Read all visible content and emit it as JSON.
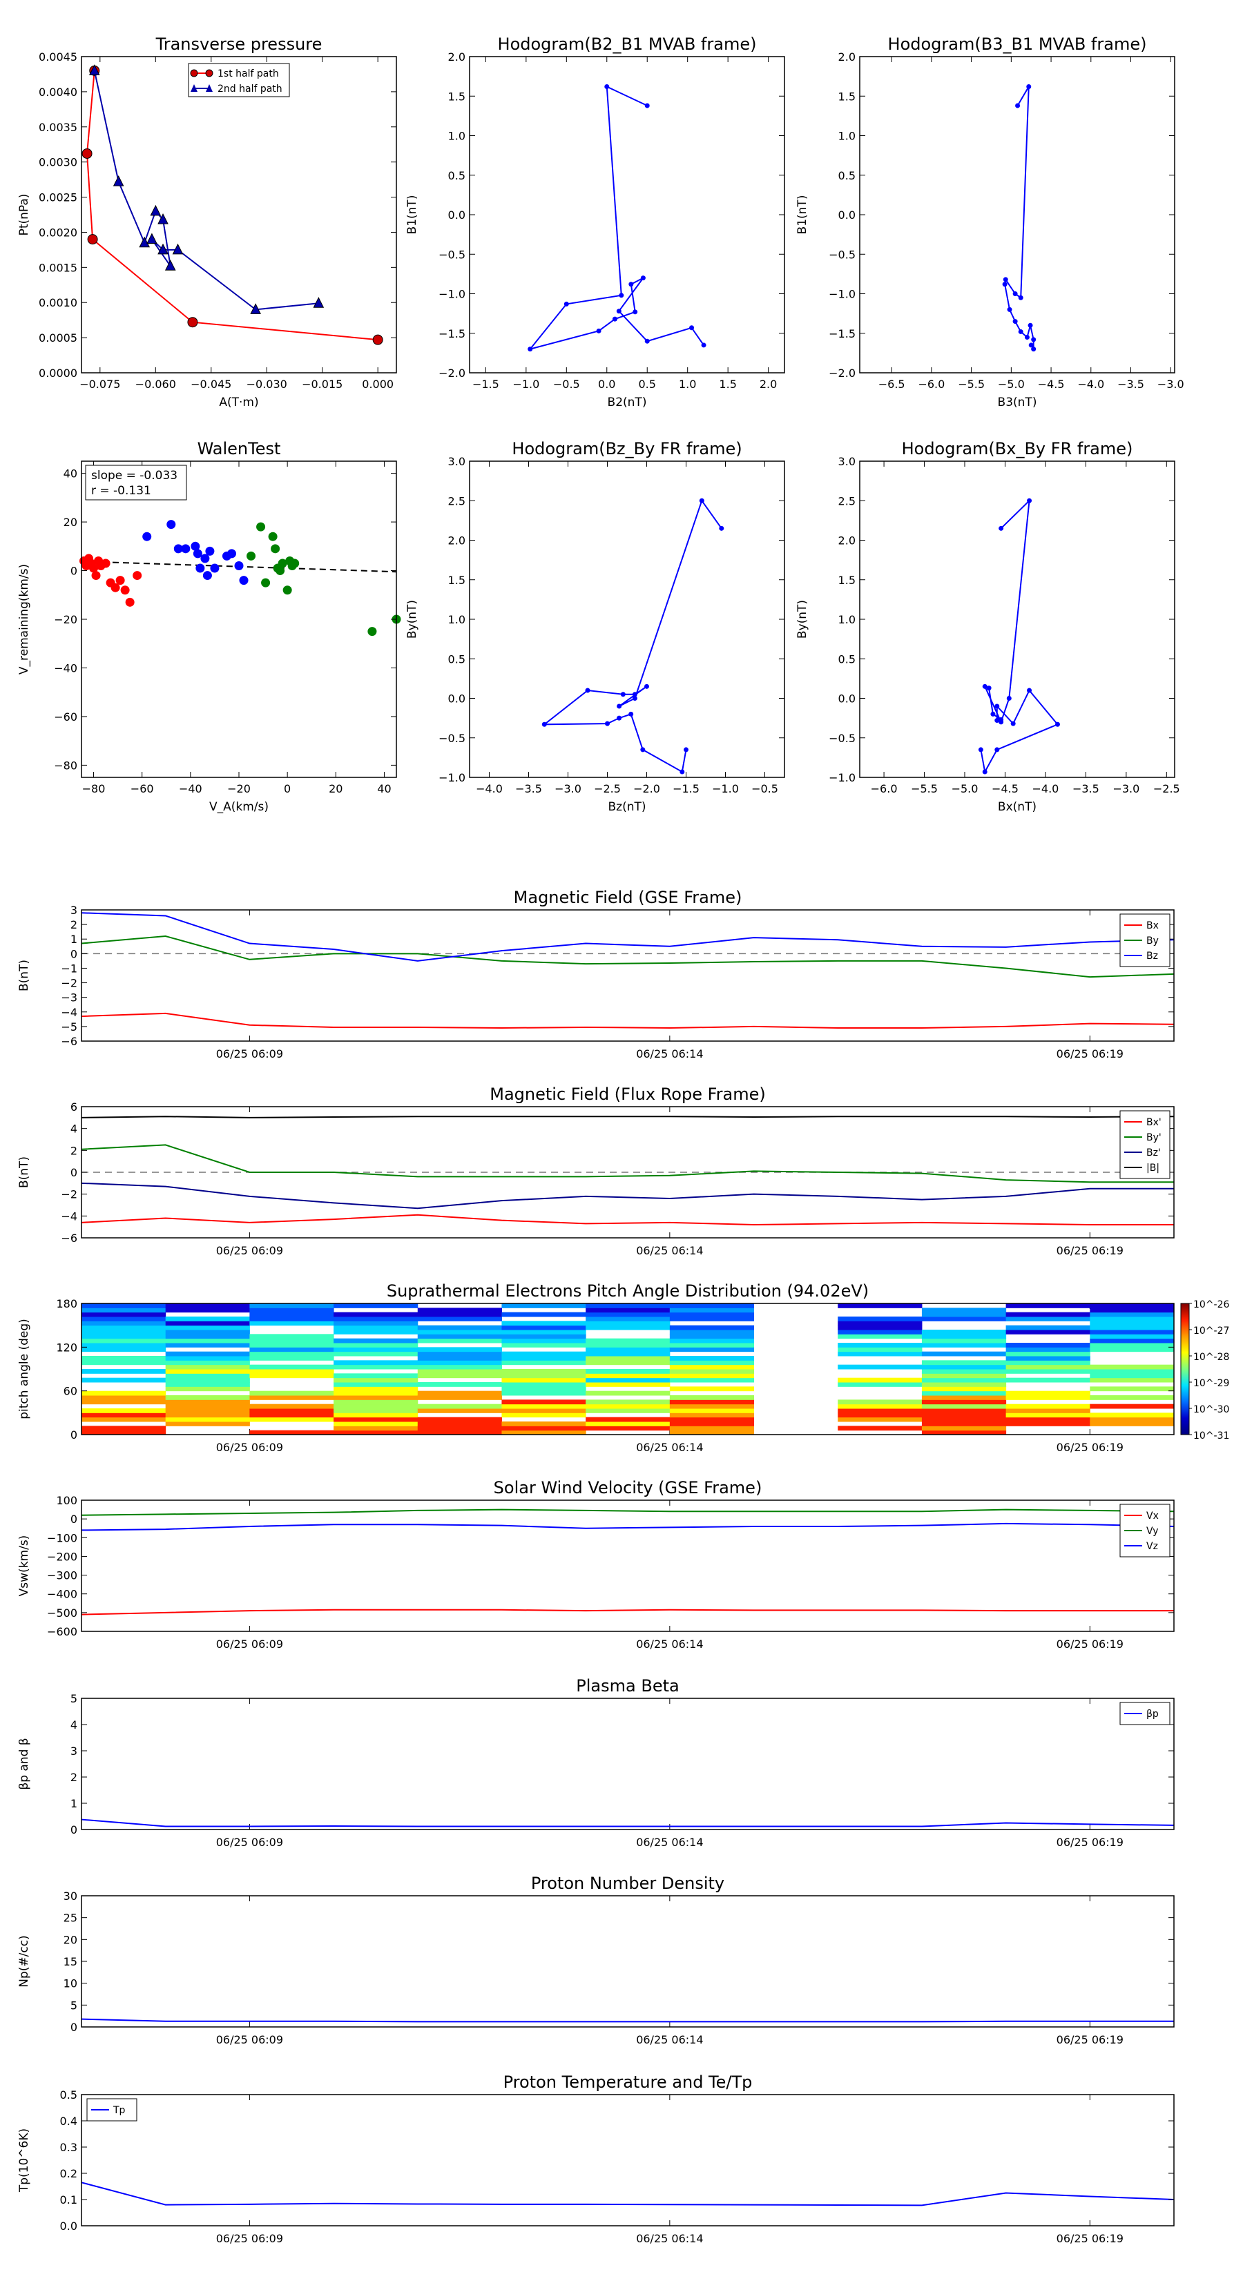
{
  "chart_data": [
    {
      "id": "tp",
      "type": "line",
      "title": "Transverse pressure",
      "xlabel": "A(T·m)",
      "ylabel": "Pt(nPa)",
      "xlim": [
        -0.08,
        0.005
      ],
      "ylim": [
        0,
        0.0045
      ],
      "xticks": [
        -0.075,
        -0.06,
        -0.045,
        -0.03,
        -0.015,
        0.0
      ],
      "xtick_labels": [
        "−0.075",
        "−0.060",
        "−0.045",
        "−0.030",
        "−0.015",
        "0.000"
      ],
      "yticks": [
        0,
        0.0005,
        0.001,
        0.0015,
        0.002,
        0.0025,
        0.003,
        0.0035,
        0.004,
        0.0045
      ],
      "ytick_labels": [
        "0.0000",
        "0.0005",
        "0.0010",
        "0.0015",
        "0.0020",
        "0.0025",
        "0.0030",
        "0.0035",
        "0.0040",
        "0.0045"
      ],
      "legend": [
        "1st half path",
        "2nd half path"
      ],
      "series": [
        {
          "name": "1st half path",
          "color": "#ff0000",
          "marker": "circle",
          "x": [
            0.0,
            -0.05,
            -0.077,
            -0.0785,
            -0.0765
          ],
          "y": [
            0.00047,
            0.00072,
            0.0019,
            0.00312,
            0.0043
          ]
        },
        {
          "name": "2nd half path",
          "color": "#0000aa",
          "marker": "triangle",
          "x": [
            -0.0765,
            -0.07,
            -0.063,
            -0.06,
            -0.058,
            -0.056,
            -0.061,
            -0.058,
            -0.054,
            -0.033,
            -0.016
          ],
          "y": [
            0.0043,
            0.00272,
            0.00185,
            0.0023,
            0.00218,
            0.00152,
            0.0019,
            0.00175,
            0.00175,
            0.0009,
            0.00099
          ]
        }
      ]
    },
    {
      "id": "h1",
      "type": "line",
      "title": "Hodogram(B2_B1 MVAB frame)",
      "xlabel": "B2(nT)",
      "ylabel": "B1(nT)",
      "xlim": [
        -1.7,
        2.2
      ],
      "ylim": [
        -2.0,
        2.0
      ],
      "xticks": [
        -1.5,
        -1.0,
        -0.5,
        0.0,
        0.5,
        1.0,
        1.5,
        2.0
      ],
      "xtick_labels": [
        "−1.5",
        "−1.0",
        "−0.5",
        "0.0",
        "0.5",
        "1.0",
        "1.5",
        "2.0"
      ],
      "yticks": [
        -2.0,
        -1.5,
        -1.0,
        -0.5,
        0.0,
        0.5,
        1.0,
        1.5,
        2.0
      ],
      "ytick_labels": [
        "−2.0",
        "−1.5",
        "−1.0",
        "−0.5",
        "0.0",
        "0.5",
        "1.0",
        "1.5",
        "2.0"
      ],
      "series": [
        {
          "color": "#0000ff",
          "marker": "dot",
          "x": [
            0.5,
            0.0,
            0.18,
            -0.5,
            -0.95,
            -0.1,
            0.1,
            0.35,
            0.3,
            0.45,
            0.15,
            0.5,
            1.05,
            1.2
          ],
          "y": [
            1.38,
            1.62,
            -1.02,
            -1.13,
            -1.7,
            -1.47,
            -1.32,
            -1.23,
            -0.88,
            -0.8,
            -1.22,
            -1.6,
            -1.43,
            -1.65
          ]
        }
      ]
    },
    {
      "id": "h2",
      "type": "line",
      "title": "Hodogram(B3_B1 MVAB frame)",
      "xlabel": "B3(nT)",
      "ylabel": "B1(nT)",
      "xlim": [
        -6.9,
        -2.95
      ],
      "ylim": [
        -2.0,
        2.0
      ],
      "xticks": [
        -6.5,
        -6.0,
        -5.5,
        -5.0,
        -4.5,
        -4.0,
        -3.5,
        -3.0
      ],
      "xtick_labels": [
        "−6.5",
        "−6.0",
        "−5.5",
        "−5.0",
        "−4.5",
        "−4.0",
        "−3.5",
        "−3.0"
      ],
      "yticks": [
        -2.0,
        -1.5,
        -1.0,
        -0.5,
        0.0,
        0.5,
        1.0,
        1.5,
        2.0
      ],
      "ytick_labels": [
        "−2.0",
        "−1.5",
        "−1.0",
        "−0.5",
        "0.0",
        "0.5",
        "1.0",
        "1.5",
        "2.0"
      ],
      "series": [
        {
          "color": "#0000ff",
          "marker": "dot",
          "x": [
            -4.92,
            -4.78,
            -4.88,
            -4.95,
            -5.07,
            -5.08,
            -5.02,
            -4.95,
            -4.88,
            -4.8,
            -4.76,
            -4.72,
            -4.72,
            -4.75
          ],
          "y": [
            1.38,
            1.62,
            -1.05,
            -1.0,
            -0.82,
            -0.88,
            -1.2,
            -1.35,
            -1.48,
            -1.55,
            -1.4,
            -1.58,
            -1.7,
            -1.65
          ]
        }
      ]
    },
    {
      "id": "walen",
      "type": "scatter",
      "title": "WalenTest",
      "xlabel": "V_A(km/s)",
      "ylabel": "V_remaining(km/s)",
      "xlim": [
        -85,
        45
      ],
      "ylim": [
        -85,
        45
      ],
      "xticks": [
        -80,
        -60,
        -40,
        -20,
        0,
        20,
        40
      ],
      "xtick_labels": [
        "−80",
        "−60",
        "−40",
        "−20",
        "0",
        "20",
        "40"
      ],
      "yticks": [
        -80,
        -60,
        -40,
        -20,
        0,
        20,
        40
      ],
      "ytick_labels": [
        "−80",
        "−60",
        "−40",
        "−20",
        "0",
        "20",
        "40"
      ],
      "annotation": [
        "slope = -0.033",
        "r = -0.131"
      ],
      "fit": {
        "slope": -0.033,
        "intercept": 1.0
      },
      "series": [
        {
          "color": "#ff0000",
          "x": [
            -84,
            -83,
            -82,
            -81,
            -80,
            -79,
            -78,
            -77,
            -75,
            -73,
            -71,
            -69,
            -67,
            -65,
            -62
          ],
          "y": [
            4,
            2,
            5,
            3,
            1,
            -2,
            4,
            2,
            3,
            -5,
            -7,
            -4,
            -8,
            -13,
            -2
          ]
        },
        {
          "color": "#0000ff",
          "x": [
            -58,
            -48,
            -45,
            -42,
            -38,
            -37,
            -36,
            -34,
            -33,
            -32,
            -30,
            -25,
            -23,
            -20,
            -18
          ],
          "y": [
            14,
            19,
            9,
            9,
            10,
            7,
            1,
            5,
            -2,
            8,
            1,
            6,
            7,
            2,
            -4
          ]
        },
        {
          "color": "#008000",
          "x": [
            -15,
            -11,
            -9,
            -6,
            -5,
            -4,
            -3,
            -2,
            0,
            1,
            2,
            3,
            35,
            45
          ],
          "y": [
            6,
            18,
            -5,
            14,
            9,
            1,
            0,
            3,
            -8,
            4,
            2,
            3,
            -25,
            -20
          ]
        }
      ]
    },
    {
      "id": "h3",
      "type": "line",
      "title": "Hodogram(Bz_By FR frame)",
      "xlabel": "Bz(nT)",
      "ylabel": "By(nT)",
      "xlim": [
        -4.25,
        -0.25
      ],
      "ylim": [
        -1.0,
        3.0
      ],
      "xticks": [
        -4.0,
        -3.5,
        -3.0,
        -2.5,
        -2.0,
        -1.5,
        -1.0,
        -0.5
      ],
      "xtick_labels": [
        "−4.0",
        "−3.5",
        "−3.0",
        "−2.5",
        "−2.0",
        "−1.5",
        "−1.0",
        "−0.5"
      ],
      "yticks": [
        -1.0,
        -0.5,
        0.0,
        0.5,
        1.0,
        1.5,
        2.0,
        2.5,
        3.0
      ],
      "ytick_labels": [
        "−1.0",
        "−0.5",
        "0.0",
        "0.5",
        "1.0",
        "1.5",
        "2.0",
        "2.5",
        "3.0"
      ],
      "series": [
        {
          "color": "#0000ff",
          "marker": "dot",
          "x": [
            -1.05,
            -1.3,
            -2.15,
            -2.35,
            -2.0,
            -2.15,
            -2.3,
            -2.75,
            -3.3,
            -2.5,
            -2.35,
            -2.2,
            -2.05,
            -1.55,
            -1.5
          ],
          "y": [
            2.15,
            2.5,
            0.0,
            -0.1,
            0.15,
            0.05,
            0.05,
            0.1,
            -0.33,
            -0.32,
            -0.25,
            -0.2,
            -0.65,
            -0.93,
            -0.65
          ]
        }
      ]
    },
    {
      "id": "h4",
      "type": "line",
      "title": "Hodogram(Bx_By FR frame)",
      "xlabel": "Bx(nT)",
      "ylabel": "By(nT)",
      "xlim": [
        -6.3,
        -2.4
      ],
      "ylim": [
        -1.0,
        3.0
      ],
      "xticks": [
        -6.0,
        -5.5,
        -5.0,
        -4.5,
        -4.0,
        -3.5,
        -3.0,
        -2.5
      ],
      "xtick_labels": [
        "−6.0",
        "−5.5",
        "−5.0",
        "−4.5",
        "−4.0",
        "−3.5",
        "−3.0",
        "−2.5"
      ],
      "yticks": [
        -1.0,
        -0.5,
        0.0,
        0.5,
        1.0,
        1.5,
        2.0,
        2.5,
        3.0
      ],
      "ytick_labels": [
        "−1.0",
        "−0.5",
        "0.0",
        "0.5",
        "1.0",
        "1.5",
        "2.0",
        "2.5",
        "3.0"
      ],
      "series": [
        {
          "color": "#0000ff",
          "marker": "dot",
          "x": [
            -4.55,
            -4.2,
            -4.45,
            -4.55,
            -4.75,
            -4.7,
            -4.65,
            -4.55,
            -4.6,
            -4.6,
            -4.4,
            -4.2,
            -3.85,
            -4.6,
            -4.75,
            -4.8
          ],
          "y": [
            2.15,
            2.5,
            0.0,
            -0.3,
            0.15,
            0.13,
            -0.2,
            -0.27,
            -0.28,
            -0.1,
            -0.32,
            0.1,
            -0.33,
            -0.65,
            -0.93,
            -0.65
          ]
        }
      ]
    },
    {
      "id": "mag_gse",
      "type": "line",
      "title": "Magnetic Field (GSE Frame)",
      "ylabel": "B(nT)",
      "ylim": [
        -6,
        3
      ],
      "yticks": [
        -6,
        -5,
        -4,
        -3,
        -2,
        -1,
        0,
        1,
        2,
        3
      ],
      "ytick_labels": [
        "−6",
        "−5",
        "−4",
        "−3",
        "−2",
        "−1",
        "0",
        "1",
        "2",
        "3"
      ],
      "zero_line": true,
      "legend": [
        "Bx",
        "By",
        "Bz"
      ],
      "series": [
        {
          "name": "Bx",
          "color": "#ff0000",
          "y": [
            -4.3,
            -4.1,
            -4.9,
            -5.05,
            -5.05,
            -5.1,
            -5.05,
            -5.1,
            -5.0,
            -5.1,
            -5.1,
            -5.0,
            -4.8,
            -4.85
          ]
        },
        {
          "name": "By",
          "color": "#008000",
          "y": [
            0.7,
            1.2,
            -0.4,
            0.0,
            0.0,
            -0.5,
            -0.7,
            -0.65,
            -0.55,
            -0.5,
            -0.5,
            -1.0,
            -1.6,
            -1.4
          ]
        },
        {
          "name": "Bz",
          "color": "#0000ff",
          "y": [
            2.8,
            2.6,
            0.7,
            0.3,
            -0.5,
            0.2,
            0.7,
            0.5,
            1.1,
            0.95,
            0.5,
            0.45,
            0.8,
            0.95
          ]
        }
      ]
    },
    {
      "id": "mag_fr",
      "type": "line",
      "title": "Magnetic Field (Flux Rope Frame)",
      "ylabel": "B(nT)",
      "ylim": [
        -6,
        6
      ],
      "yticks": [
        -6,
        -4,
        -2,
        0,
        2,
        4,
        6
      ],
      "ytick_labels": [
        "−6",
        "−4",
        "−2",
        "0",
        "2",
        "4",
        "6"
      ],
      "zero_line": true,
      "legend": [
        "Bx'",
        "By'",
        "Bz'",
        "|B|"
      ],
      "series": [
        {
          "name": "Bx'",
          "color": "#ff0000",
          "y": [
            -4.6,
            -4.2,
            -4.6,
            -4.3,
            -3.9,
            -4.4,
            -4.7,
            -4.6,
            -4.8,
            -4.7,
            -4.6,
            -4.7,
            -4.8,
            -4.8
          ]
        },
        {
          "name": "By'",
          "color": "#008000",
          "y": [
            2.1,
            2.5,
            0.0,
            0.0,
            -0.4,
            -0.4,
            -0.4,
            -0.3,
            0.1,
            0.0,
            -0.1,
            -0.7,
            -0.9,
            -0.9
          ]
        },
        {
          "name": "Bz'",
          "color": "#00008b",
          "y": [
            -1.0,
            -1.3,
            -2.2,
            -2.8,
            -3.3,
            -2.6,
            -2.2,
            -2.4,
            -2.0,
            -2.2,
            -2.5,
            -2.2,
            -1.5,
            -1.5
          ]
        },
        {
          "name": "|B|",
          "color": "#000000",
          "y": [
            5.0,
            5.1,
            5.0,
            5.05,
            5.1,
            5.1,
            5.1,
            5.1,
            5.05,
            5.1,
            5.1,
            5.1,
            5.05,
            5.1
          ]
        }
      ]
    },
    {
      "id": "pad",
      "type": "heatmap",
      "title": "Suprathermal Electrons Pitch Angle Distribution (94.02eV)",
      "ylabel": "pitch angle (deg)",
      "ylim": [
        0,
        180
      ],
      "yticks": [
        0,
        60,
        120,
        180
      ],
      "ytick_labels": [
        "0",
        "60",
        "120",
        "180"
      ],
      "colorbar_labels": [
        "10^-26",
        "10^-27",
        "10^-28",
        "10^-29",
        "10^-30",
        "10^-31"
      ],
      "empty_columns": [
        8
      ]
    },
    {
      "id": "vsw",
      "type": "line",
      "title": "Solar Wind Velocity (GSE Frame)",
      "ylabel": "Vsw(km/s)",
      "ylim": [
        -600,
        100
      ],
      "yticks": [
        -600,
        -500,
        -400,
        -300,
        -200,
        -100,
        0,
        100
      ],
      "ytick_labels": [
        "−600",
        "−500",
        "−400",
        "−300",
        "−200",
        "−100",
        "0",
        "100"
      ],
      "legend": [
        "Vx",
        "Vy",
        "Vz"
      ],
      "series": [
        {
          "name": "Vx",
          "color": "#ff0000",
          "y": [
            -510,
            -500,
            -490,
            -485,
            -485,
            -485,
            -490,
            -485,
            -487,
            -487,
            -487,
            -490,
            -490,
            -490
          ]
        },
        {
          "name": "Vy",
          "color": "#008000",
          "y": [
            20,
            25,
            30,
            35,
            45,
            50,
            45,
            40,
            40,
            40,
            40,
            50,
            45,
            40
          ]
        },
        {
          "name": "Vz",
          "color": "#0000ff",
          "y": [
            -60,
            -55,
            -40,
            -30,
            -30,
            -35,
            -50,
            -45,
            -40,
            -40,
            -35,
            -25,
            -30,
            -40
          ]
        }
      ]
    },
    {
      "id": "beta",
      "type": "line",
      "title": "Plasma Beta",
      "ylabel": "βp and β",
      "ylim": [
        0,
        5
      ],
      "yticks": [
        0,
        1,
        2,
        3,
        4,
        5
      ],
      "ytick_labels": [
        "0",
        "1",
        "2",
        "3",
        "4",
        "5"
      ],
      "legend": [
        "βp"
      ],
      "series": [
        {
          "name": "βp",
          "color": "#0000ff",
          "y": [
            0.38,
            0.12,
            0.12,
            0.13,
            0.12,
            0.12,
            0.12,
            0.12,
            0.12,
            0.12,
            0.12,
            0.25,
            0.2,
            0.16
          ]
        }
      ]
    },
    {
      "id": "np",
      "type": "line",
      "title": "Proton Number Density",
      "ylabel": "Np(#/cc)",
      "ylim": [
        0,
        30
      ],
      "yticks": [
        0,
        5,
        10,
        15,
        20,
        25,
        30
      ],
      "ytick_labels": [
        "0",
        "5",
        "10",
        "15",
        "20",
        "25",
        "30"
      ],
      "series": [
        {
          "color": "#0000ff",
          "y": [
            1.8,
            1.3,
            1.3,
            1.3,
            1.2,
            1.2,
            1.2,
            1.2,
            1.2,
            1.2,
            1.2,
            1.3,
            1.3,
            1.3
          ]
        }
      ]
    },
    {
      "id": "tp_temp",
      "type": "line",
      "title": "Proton Temperature and Te/Tp",
      "ylabel": "Tp(10^6K)",
      "ylim": [
        0,
        0.5
      ],
      "yticks": [
        0,
        0.1,
        0.2,
        0.3,
        0.4,
        0.5
      ],
      "ytick_labels": [
        "0.0",
        "0.1",
        "0.2",
        "0.3",
        "0.4",
        "0.5"
      ],
      "legend": [
        "Tp"
      ],
      "series": [
        {
          "name": "Tp",
          "color": "#0000ff",
          "y": [
            0.165,
            0.08,
            0.082,
            0.085,
            0.083,
            0.082,
            0.082,
            0.081,
            0.08,
            0.079,
            0.078,
            0.125,
            0.112,
            0.1
          ]
        }
      ]
    }
  ],
  "time_axis": {
    "ticks": [
      "06/25 06:09",
      "06/25 06:14",
      "06/25 06:19"
    ],
    "tick_values": [
      2,
      7,
      12
    ],
    "range": [
      0,
      13
    ]
  }
}
